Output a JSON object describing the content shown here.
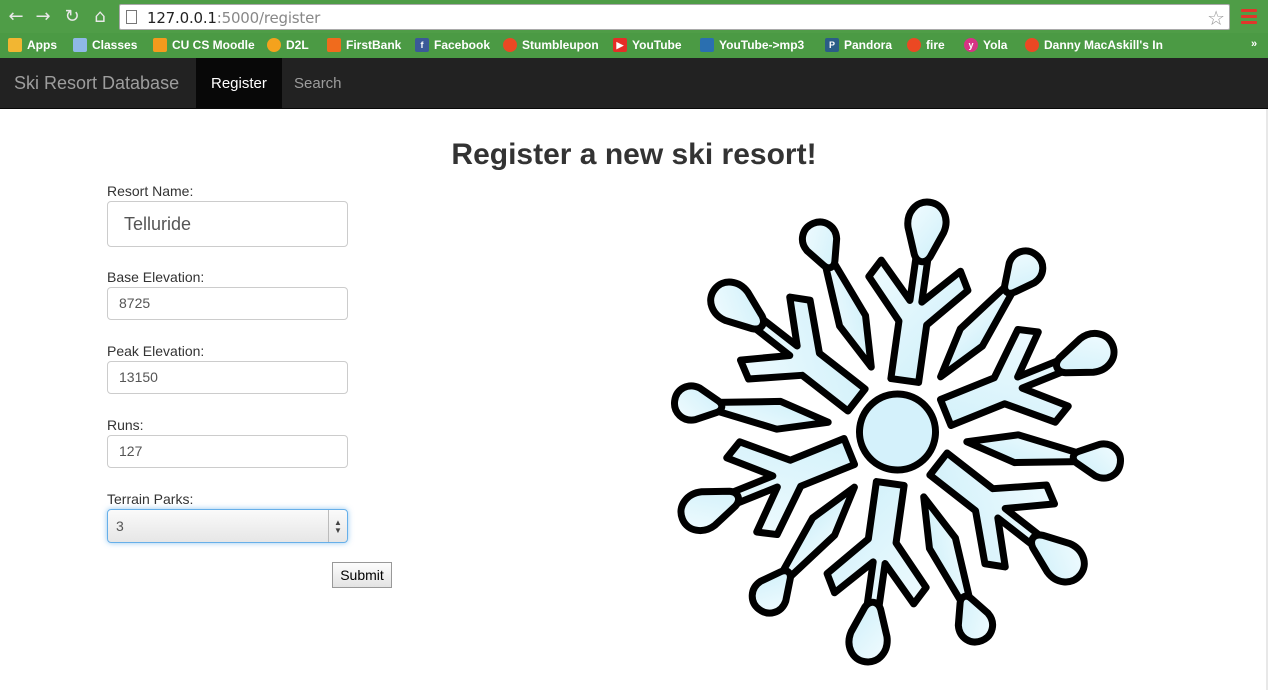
{
  "browser": {
    "url_host": "127.0.0.1",
    "url_rest": ":5000/register",
    "bookmarks": [
      {
        "label": "Apps",
        "color": "#f2b632"
      },
      {
        "label": "Classes",
        "color": "#8fb8e8"
      },
      {
        "label": "CU CS Moodle",
        "color": "#f49a1d"
      },
      {
        "label": "D2L",
        "color": "#f4a21d"
      },
      {
        "label": "FirstBank",
        "color": "#f06b1d"
      },
      {
        "label": "Facebook",
        "color": "#3b5998"
      },
      {
        "label": "Stumbleupon",
        "color": "#eb4823"
      },
      {
        "label": "YouTube",
        "color": "#e52d27"
      },
      {
        "label": "YouTube->mp3",
        "color": "#2a6fb0"
      },
      {
        "label": "Pandora",
        "color": "#2b5d87"
      },
      {
        "label": "fire",
        "color": "#eb4823"
      },
      {
        "label": "Yola",
        "color": "#d63384"
      },
      {
        "label": "Danny MacAskill's In",
        "color": "#eb4823"
      }
    ],
    "more": "»"
  },
  "navbar": {
    "brand": "Ski Resort Database",
    "items": [
      {
        "label": "Register",
        "active": true
      },
      {
        "label": "Search",
        "active": false
      }
    ]
  },
  "form": {
    "title": "Register a new ski resort!",
    "resort_name_label": "Resort Name:",
    "resort_name_value": "Telluride",
    "base_elevation_label": "Base Elevation:",
    "base_elevation_value": "8725",
    "peak_elevation_label": "Peak Elevation:",
    "peak_elevation_value": "13150",
    "runs_label": "Runs:",
    "runs_value": "127",
    "terrain_parks_label": "Terrain Parks:",
    "terrain_parks_value": "3",
    "submit_label": "Submit"
  },
  "colors": {
    "browser_green": "#4b9a44",
    "navbar_bg": "#222222",
    "snowflake_fill": "#dff6fb"
  }
}
